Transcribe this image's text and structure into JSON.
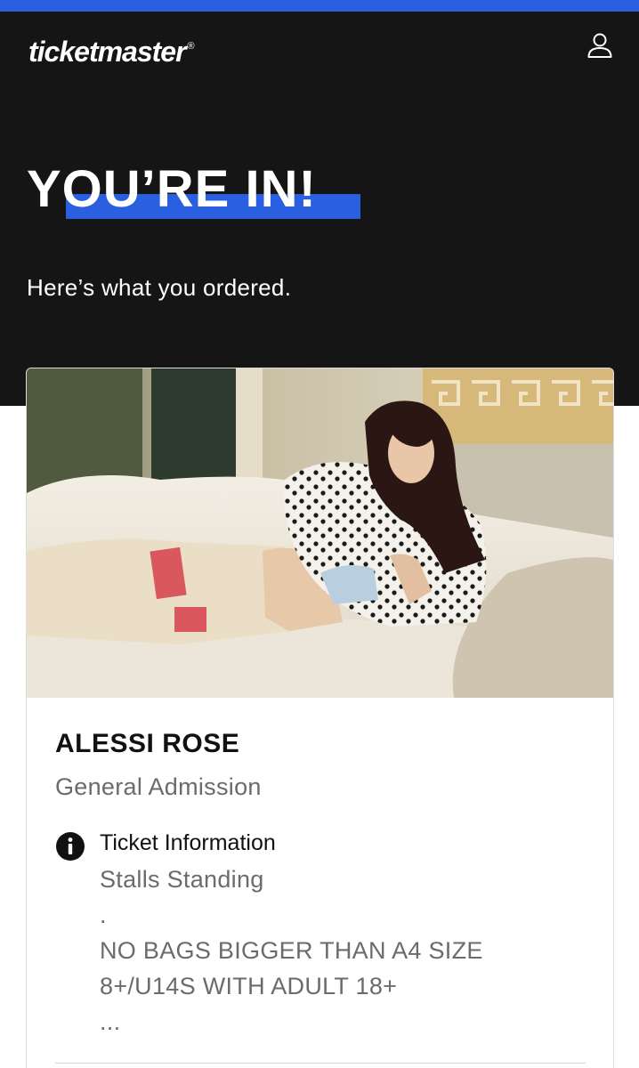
{
  "brand": {
    "logo_text": "ticketmaster",
    "registered_mark": "®"
  },
  "header": {
    "account_icon": "user-icon"
  },
  "confirmation": {
    "headline": "YOU’RE IN!",
    "subtitle": "Here’s what you ordered."
  },
  "order": {
    "event_name": "ALESSI ROSE",
    "admission_type": "General Admission",
    "info_icon": "info-icon",
    "ticket_info_title": "Ticket Information",
    "ticket_info_lines": [
      "Stalls Standing",
      ".",
      "NO BAGS BIGGER THAN A4 SIZE",
      "8+/U14S WITH ADULT 18+",
      "..."
    ]
  },
  "colors": {
    "accent_blue": "#2a5fe0",
    "hero_background": "#151515",
    "muted_text": "#6b6b6b"
  }
}
